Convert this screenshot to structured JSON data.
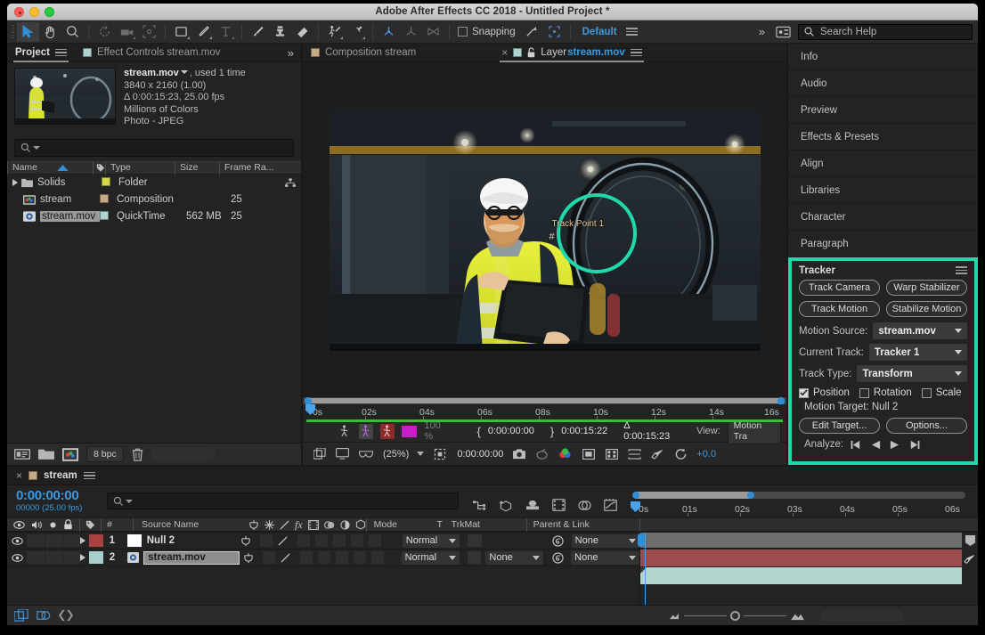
{
  "window": {
    "title": "Adobe After Effects CC 2018 - Untitled Project *",
    "accent_teal": "#1fd9aa",
    "accent_blue": "#3a9ae0"
  },
  "toolbar": {
    "tools": [
      {
        "name": "selection-tool",
        "glyph": "arrow"
      },
      {
        "name": "hand-tool",
        "glyph": "hand"
      },
      {
        "name": "zoom-tool",
        "glyph": "magnifier"
      },
      {
        "name": "rotation-tool",
        "glyph": "rotate"
      },
      {
        "name": "camera-tool",
        "glyph": "camera"
      },
      {
        "name": "anchor-point-tool",
        "glyph": "anchor"
      },
      {
        "name": "shape-tool",
        "glyph": "square"
      },
      {
        "name": "pen-tool",
        "glyph": "pen"
      },
      {
        "name": "type-tool",
        "glyph": "T"
      },
      {
        "name": "brush-tool",
        "glyph": "brush"
      },
      {
        "name": "clone-stamp-tool",
        "glyph": "stamp"
      },
      {
        "name": "eraser-tool",
        "glyph": "eraser"
      },
      {
        "name": "roto-brush-tool",
        "glyph": "roto"
      },
      {
        "name": "puppet-pin-tool",
        "glyph": "pin"
      }
    ],
    "snapping_label": "Snapping",
    "workspace_label": "Default",
    "search_help_placeholder": "Search Help"
  },
  "project_panel": {
    "tabs": [
      {
        "label": "Project",
        "active": true
      },
      {
        "label": "Effect Controls stream.mov",
        "active": false
      }
    ],
    "item_info": {
      "name": "stream.mov",
      "usage": ", used 1 time",
      "dimensions": "3840 x 2160 (1.00)",
      "duration": "Δ 0:00:15:23, 25.00 fps",
      "color_depth": "Millions of Colors",
      "codec": "Photo - JPEG"
    },
    "search_placeholder": "",
    "columns": [
      "Name",
      "Type",
      "Size",
      "Frame Ra..."
    ],
    "rows": [
      {
        "name": "Solids",
        "type": "Folder",
        "size": "",
        "frame_rate": "",
        "kind": "folder",
        "swatch": "#d6d64a",
        "expandable": true,
        "selected": false
      },
      {
        "name": "stream",
        "type": "Composition",
        "size": "",
        "frame_rate": "25",
        "kind": "comp",
        "swatch": "#c7ab87",
        "expandable": false,
        "selected": false
      },
      {
        "name": "stream.mov",
        "type": "QuickTime",
        "size": "562 MB",
        "frame_rate": "25",
        "kind": "footage",
        "swatch": "#aed5d2",
        "expandable": false,
        "selected": true
      }
    ],
    "footer": {
      "bit_depth": "8 bpc"
    }
  },
  "composition_panel": {
    "tabs": [
      {
        "label": "Composition stream",
        "active": false,
        "swatch": "#c7ab87"
      },
      {
        "label": "Layer stream.mov",
        "active": true,
        "swatch": "#aed5d2",
        "prefix": "Layer ",
        "link_text": "stream.mov"
      }
    ],
    "track_point": {
      "label": "Track Point 1",
      "marker": "#"
    },
    "ruler": {
      "ticks": [
        "0s",
        "02s",
        "04s",
        "06s",
        "08s",
        "10s",
        "12s",
        "14s",
        "16s"
      ]
    },
    "controls": {
      "opacity": "100 %",
      "in_point": "0:00:00:00",
      "out_point": "0:00:15:22",
      "duration": "Δ 0:00:15:23",
      "view_label": "View:",
      "view_value": "Motion Tra",
      "zoom": "(25%)",
      "current_time": "0:00:00:00",
      "exposure": "+0.0"
    }
  },
  "right_panels": {
    "items": [
      {
        "label": "Info"
      },
      {
        "label": "Audio"
      },
      {
        "label": "Preview"
      },
      {
        "label": "Effects & Presets"
      },
      {
        "label": "Align"
      },
      {
        "label": "Libraries"
      },
      {
        "label": "Character"
      },
      {
        "label": "Paragraph"
      }
    ]
  },
  "tracker_panel": {
    "title": "Tracker",
    "buttons": [
      {
        "label": "Track Camera",
        "name": "track-camera-button"
      },
      {
        "label": "Warp Stabilizer",
        "name": "warp-stabilizer-button"
      },
      {
        "label": "Track Motion",
        "name": "track-motion-button"
      },
      {
        "label": "Stabilize Motion",
        "name": "stabilize-motion-button"
      }
    ],
    "fields": [
      {
        "label": "Motion Source:",
        "value": "stream.mov",
        "name": "motion-source-select"
      },
      {
        "label": "Current Track:",
        "value": "Tracker 1",
        "name": "current-track-select"
      },
      {
        "label": "Track Type:",
        "value": "Transform",
        "name": "track-type-select"
      }
    ],
    "checkboxes": [
      {
        "label": "Position",
        "checked": true
      },
      {
        "label": "Rotation",
        "checked": false
      },
      {
        "label": "Scale",
        "checked": false
      }
    ],
    "motion_target": "Motion Target: Null 2",
    "edit_target_label": "Edit Target...",
    "options_label": "Options...",
    "analyze_label": "Analyze:"
  },
  "timeline_panel": {
    "tab_label": "stream",
    "current_time": "0:00:00:00",
    "current_frame": "00000 (25.00 fps)",
    "search_placeholder": "",
    "columns": {
      "hash": "#",
      "source_name": "Source Name",
      "mode": "Mode",
      "t": "T",
      "trkmat": "TrkMat",
      "parent": "Parent & Link"
    },
    "ruler_ticks": [
      "0s",
      "01s",
      "02s",
      "03s",
      "04s",
      "05s",
      "06s"
    ],
    "layers": [
      {
        "index": "1",
        "name": "Null 2",
        "mode": "Normal",
        "trkmat": "",
        "parent": "None",
        "label_color": "#a8413f",
        "bar_color": "#9c4c4c",
        "swatch": "#ffffff",
        "selected": false
      },
      {
        "index": "2",
        "name": "stream.mov",
        "mode": "Normal",
        "trkmat": "None",
        "parent": "None",
        "label_color": "#a8cfc9",
        "bar_color": "#b4d5ce",
        "swatch": "#aed5d2",
        "selected": true
      }
    ]
  }
}
